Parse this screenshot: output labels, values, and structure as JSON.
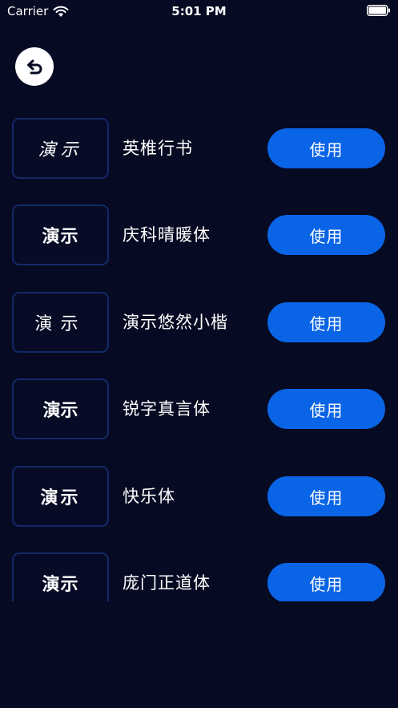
{
  "status_bar": {
    "carrier": "Carrier",
    "time": "5:01 PM"
  },
  "colors": {
    "background": "#060a22",
    "accent": "#0a64e6",
    "preview_border": "#14296a"
  },
  "icons": {
    "back": "undo-arrow-icon",
    "wifi": "wifi-icon",
    "battery": "battery-icon"
  },
  "fonts": [
    {
      "preview": "演示",
      "name": "英椎行书",
      "action": "使用"
    },
    {
      "preview": "演示",
      "name": "庆科晴暖体",
      "action": "使用"
    },
    {
      "preview": "演示",
      "name": "演示悠然小楷",
      "action": "使用"
    },
    {
      "preview": "演示",
      "name": "锐字真言体",
      "action": "使用"
    },
    {
      "preview": "演示",
      "name": "快乐体",
      "action": "使用"
    },
    {
      "preview": "演示",
      "name": "庞门正道体",
      "action": "使用"
    }
  ]
}
